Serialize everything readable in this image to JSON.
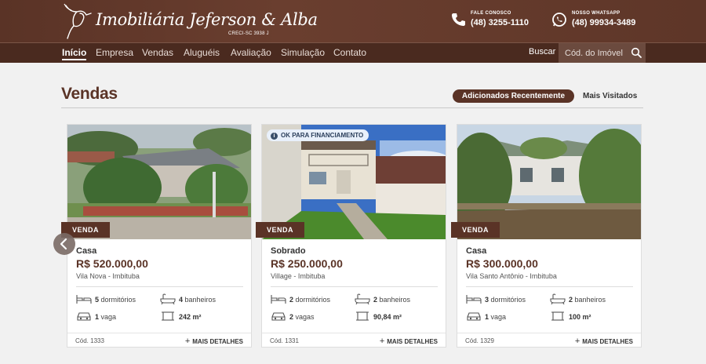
{
  "header": {
    "brand_name": "Imobiliária Jeferson & Alba",
    "creci": "CRECI-SC 3938 J",
    "phone": {
      "label": "FALE CONOSCO",
      "number": "(48) 3255-1110"
    },
    "whatsapp": {
      "label": "NOSSO WHATSAPP",
      "number": "(48) 99934-3489"
    }
  },
  "nav": {
    "items": [
      {
        "label": "Início",
        "active": true
      },
      {
        "label": "Empresa"
      },
      {
        "label": "Vendas"
      },
      {
        "label": "Aluguéis"
      },
      {
        "label": "Avaliação"
      },
      {
        "label": "Simulação"
      },
      {
        "label": "Contato"
      }
    ],
    "search_label": "Buscar",
    "search_placeholder": "Cód. do Imóvel"
  },
  "section": {
    "title": "Vendas",
    "tabs": [
      "Adicionados Recentemente",
      "Mais Visitados"
    ]
  },
  "cards": [
    {
      "badge": "VENDA",
      "type": "Casa",
      "price": "R$ 520.000,00",
      "location": "Vila Nova - Imbituba",
      "bedrooms": "5",
      "bedrooms_label": "dormitórios",
      "bathrooms": "4",
      "bathrooms_label": "banheiros",
      "garage": "1",
      "garage_label": "vaga",
      "area": "242 m²",
      "code": "Cód. 1333",
      "details": "MAIS DETALHES"
    },
    {
      "badge": "VENDA",
      "financing": "OK PARA FINANCIAMENTO",
      "type": "Sobrado",
      "price": "R$ 250.000,00",
      "location": "Village - Imbituba",
      "bedrooms": "2",
      "bedrooms_label": "dormitórios",
      "bathrooms": "2",
      "bathrooms_label": "banheiros",
      "garage": "2",
      "garage_label": "vagas",
      "area": "90,84 m²",
      "code": "Cód. 1331",
      "details": "MAIS DETALHES"
    },
    {
      "badge": "VENDA",
      "type": "Casa",
      "price": "R$ 300.000,00",
      "location": "Vila Santo Antônio - Imbituba",
      "bedrooms": "3",
      "bedrooms_label": "dormitórios",
      "bathrooms": "2",
      "bathrooms_label": "banheiros",
      "garage": "1",
      "garage_label": "vaga",
      "area": "100 m²",
      "code": "Cód. 1329",
      "details": "MAIS DETALHES"
    }
  ],
  "colors": {
    "brand": "#5a3326",
    "nav": "#4a2a1f",
    "background": "#f1f1f1"
  }
}
